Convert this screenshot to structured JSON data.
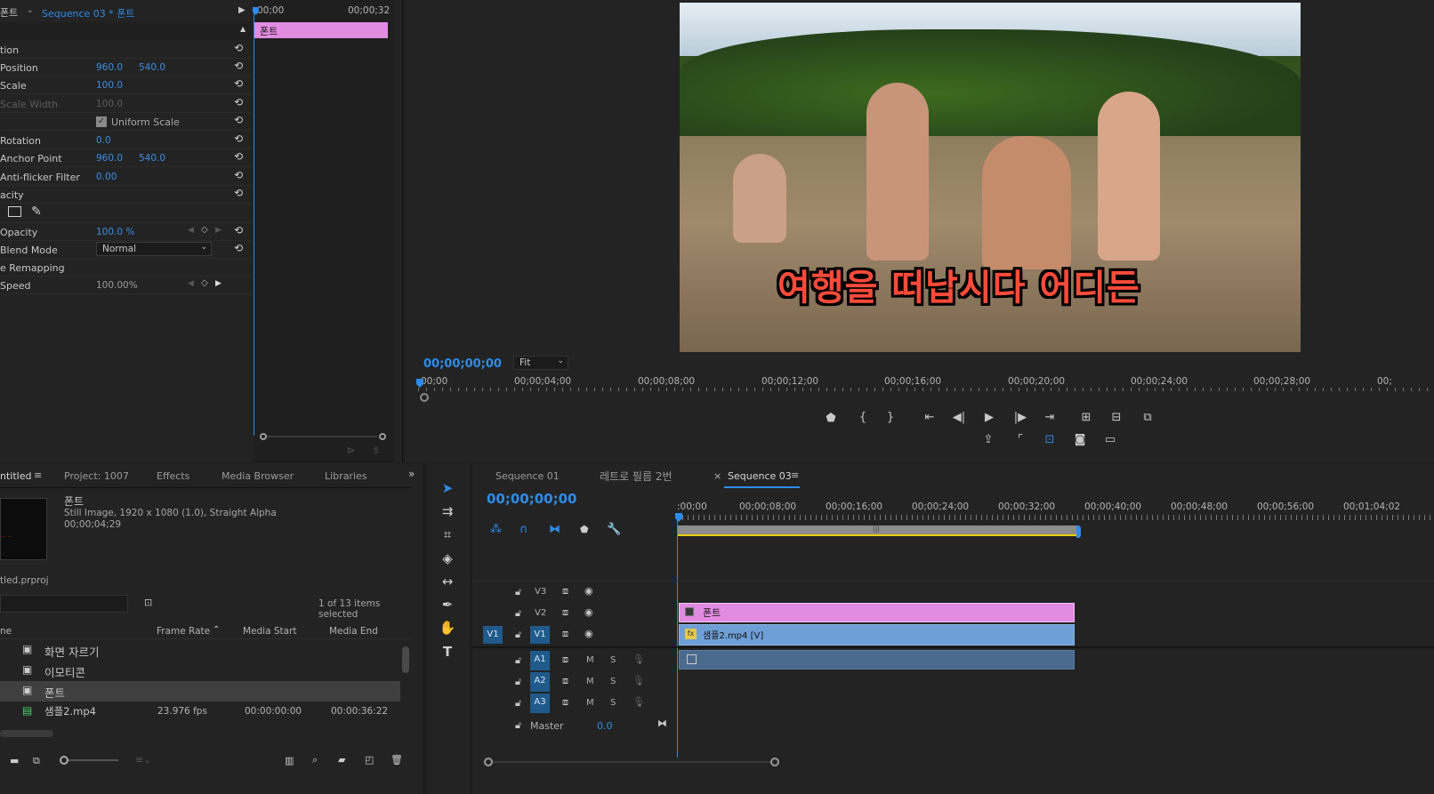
{
  "effect_controls": {
    "source_tab": "폰트",
    "sequence_tab": "Sequence 03 * 폰트",
    "timecode_start": "00;00",
    "timecode_end": "00;00;32",
    "clip_name": "폰트",
    "rows": [
      {
        "label": "tion"
      },
      {
        "label": "Position",
        "v1": "960.0",
        "v2": "540.0"
      },
      {
        "label": "Scale",
        "v1": "100.0"
      },
      {
        "label": "Scale Width",
        "v1": "100.0"
      },
      {
        "label": "Uniform Scale"
      },
      {
        "label": "Rotation",
        "v1": "0.0"
      },
      {
        "label": "Anchor Point",
        "v1": "960.0",
        "v2": "540.0"
      },
      {
        "label": "Anti-flicker Filter",
        "v1": "0.00"
      },
      {
        "label": "acity"
      },
      {
        "label": ""
      },
      {
        "label": "Opacity",
        "v1": "100.0 %"
      },
      {
        "label": "Blend Mode",
        "v1": "Normal"
      },
      {
        "label": "e Remapping"
      },
      {
        "label": "Speed",
        "v1": "100.00%"
      }
    ]
  },
  "program": {
    "caption": "여행을 떠납시다  어디든",
    "timecode": "00;00;00;00",
    "zoom": "Fit",
    "ruler": [
      "00;00",
      "00;00;04;00",
      "00;00;08;00",
      "00;00;12;00",
      "00;00;16;00",
      "00;00;20;00",
      "00;00;24;00",
      "00;00;28;00",
      "00;"
    ]
  },
  "project": {
    "tabs": [
      "ntitled",
      "Project: 1007",
      "Effects",
      "Media Browser",
      "Libraries"
    ],
    "preview_name": "폰트",
    "preview_info": "Still Image, 1920 x 1080 (1.0), Straight Alpha",
    "preview_duration": "00;00;04;29",
    "project_file": "tled.prproj",
    "selected_count": "1 of 13 items selected",
    "columns": [
      "ne",
      "Frame Rate",
      "Media Start",
      "Media End"
    ],
    "items": [
      {
        "name": "화면 자르기",
        "rate": "",
        "start": "",
        "end": ""
      },
      {
        "name": "이모티콘",
        "rate": "",
        "start": "",
        "end": ""
      },
      {
        "name": "폰트",
        "rate": "",
        "start": "",
        "end": ""
      },
      {
        "name": "샘플2.mp4",
        "rate": "23.976 fps",
        "start": "00:00:00:00",
        "end": "00:00:36:22"
      }
    ]
  },
  "timeline": {
    "tabs": [
      "Sequence 01",
      "레트로 필름 2번",
      "Sequence 03"
    ],
    "timecode": "00;00;00;00",
    "ruler": [
      ":00;00",
      "00;00;08;00",
      "00;00;16;00",
      "00;00;24;00",
      "00;00;32;00",
      "00;00;40;00",
      "00;00;48;00",
      "00;00;56;00",
      "00;01;04;02"
    ],
    "video_tracks": [
      "V3",
      "V2",
      "V1"
    ],
    "audio_tracks": [
      "A1",
      "A2",
      "A3"
    ],
    "source_patch": "V1",
    "master_label": "Master",
    "master_value": "0.0",
    "clip_v2": "폰트",
    "clip_v1": "샘플2.mp4 [V]",
    "fx_badge": "fx",
    "mute": "M",
    "solo": "S"
  }
}
